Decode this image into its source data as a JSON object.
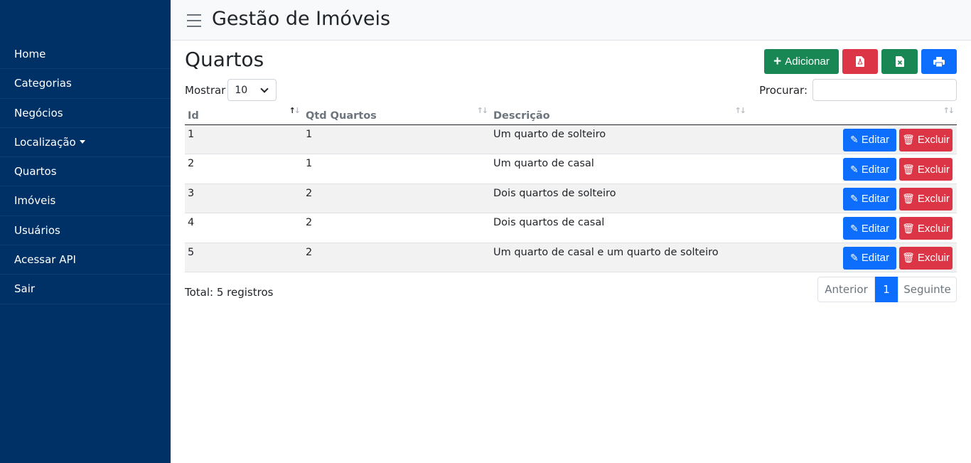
{
  "header": {
    "title": "Gestão de Imóveis"
  },
  "sidebar": {
    "items": [
      {
        "label": "Home"
      },
      {
        "label": "Categorias"
      },
      {
        "label": "Negócios"
      },
      {
        "label": "Localização"
      },
      {
        "label": "Quartos"
      },
      {
        "label": "Imóveis"
      },
      {
        "label": "Usuários"
      },
      {
        "label": "Acessar API"
      },
      {
        "label": "Sair"
      }
    ]
  },
  "page": {
    "title": "Quartos"
  },
  "toolbar": {
    "add_label": "Adicionar",
    "icons": [
      "pdf-icon",
      "excel-icon",
      "print-icon"
    ]
  },
  "length": {
    "label": "Mostrar",
    "value": "10"
  },
  "search": {
    "label": "Procurar:",
    "value": ""
  },
  "table": {
    "columns": [
      "Id",
      "Qtd Quartos",
      "Descrição"
    ],
    "rows": [
      {
        "id": "1",
        "qtd": "1",
        "descricao": "Um quarto de solteiro"
      },
      {
        "id": "2",
        "qtd": "1",
        "descricao": "Um quarto de casal"
      },
      {
        "id": "3",
        "qtd": "2",
        "descricao": "Dois quartos de solteiro"
      },
      {
        "id": "4",
        "qtd": "2",
        "descricao": "Dois quartos de casal"
      },
      {
        "id": "5",
        "qtd": "2",
        "descricao": "Um quarto de casal e um quarto de solteiro"
      }
    ],
    "edit_label": "Editar",
    "delete_label": "Excluir"
  },
  "footer": {
    "total": "Total: 5 registros"
  },
  "pagination": {
    "prev": "Anterior",
    "current": "1",
    "next": "Seguinte"
  },
  "colors": {
    "sidebar": "#003166",
    "primary": "#0d6efd",
    "success": "#198754",
    "danger": "#dc3545"
  }
}
